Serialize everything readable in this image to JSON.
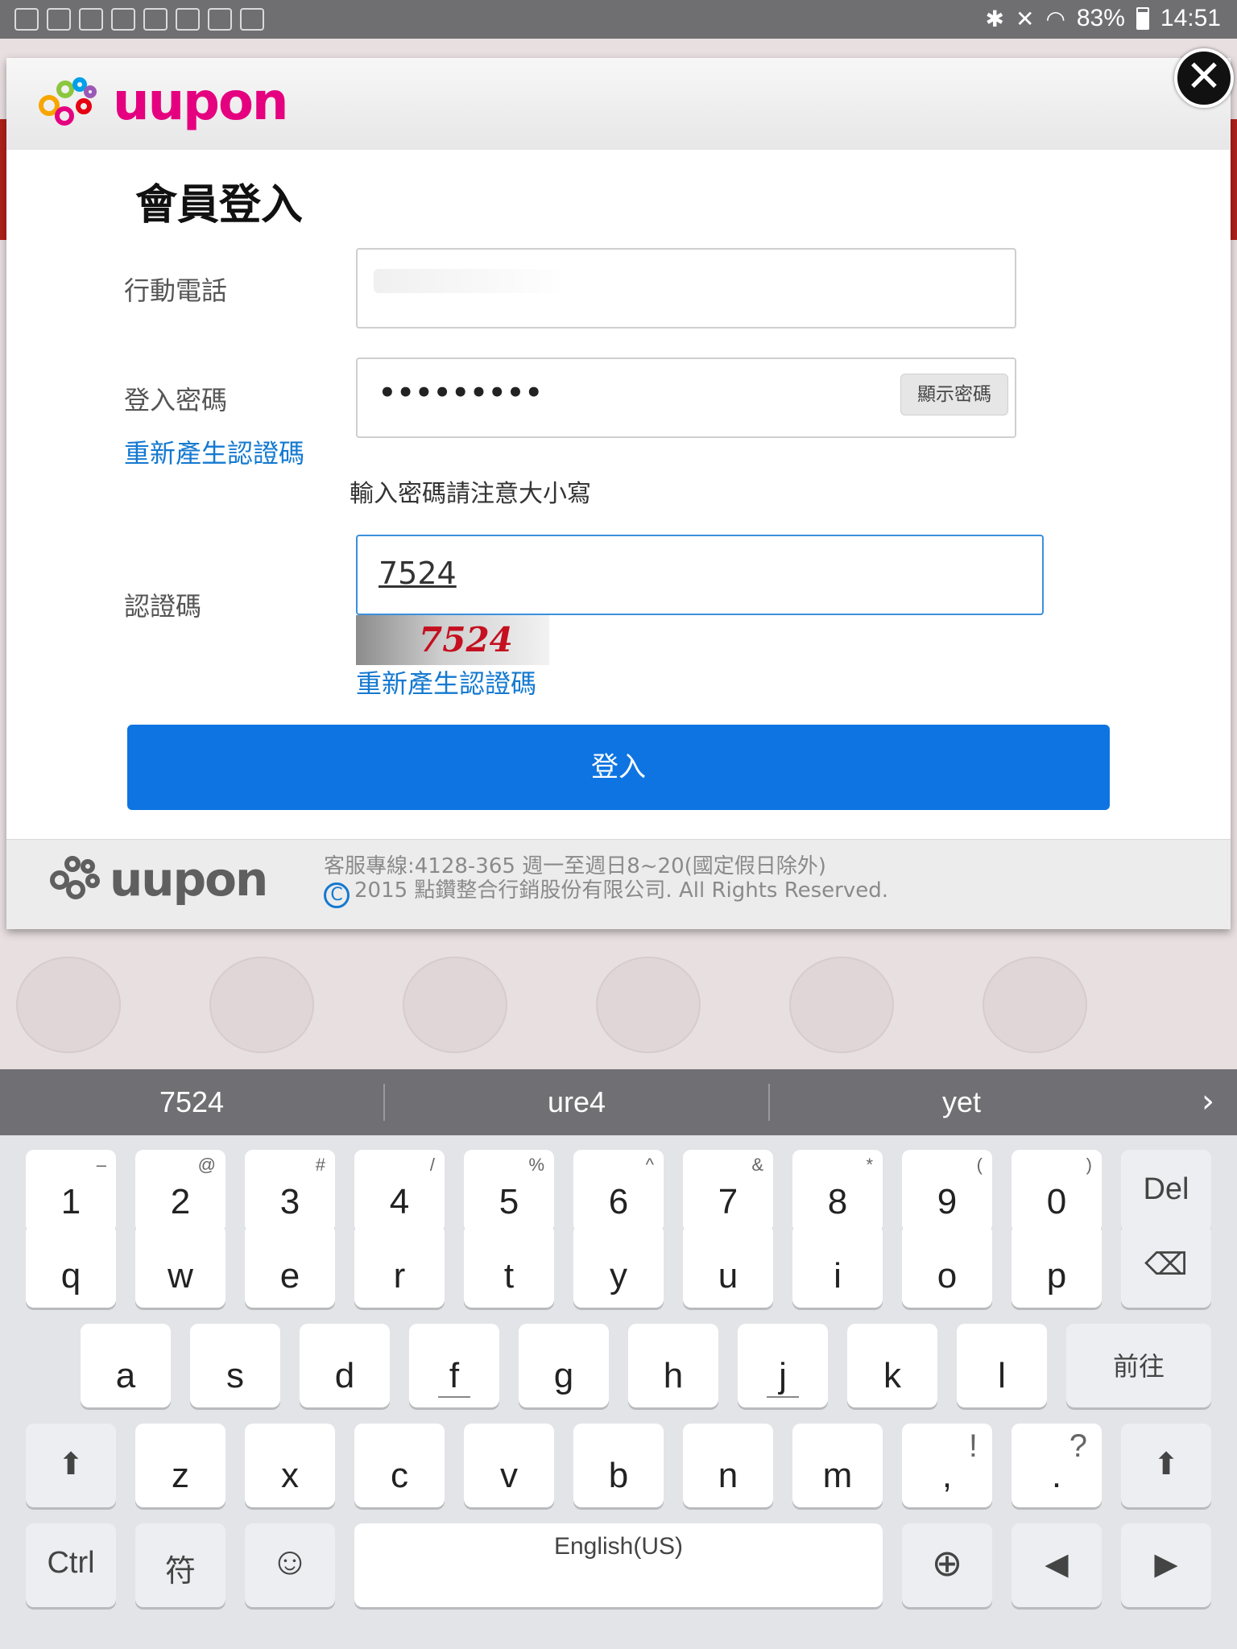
{
  "status_bar": {
    "battery": "83%",
    "time": "14:51"
  },
  "modal": {
    "brand": "uupon",
    "close_symbol": "✕",
    "title": "會員登入",
    "phone_label": "行動電話",
    "password_label": "登入密碼",
    "password_value": "•••••••••",
    "show_password_label": "顯示密碼",
    "regen_link_left": "重新產生認證碼",
    "password_hint": "輸入密碼請注意大小寫",
    "captcha_label": "認證碼",
    "captcha_input_value": "7524",
    "captcha_image_text": "7524",
    "regen_link": "重新產生認證碼",
    "login_button": "登入",
    "footer_logo": "uupon",
    "footer_service": "客服專線:4128-365 週一至週日8~20(國定假日除外)",
    "footer_copyright": "2015 點鑽整合行銷股份有限公司. All Rights Reserved.",
    "copyright_symbol": "C"
  },
  "suggestions": {
    "items": [
      "7524",
      "ure4",
      "yet"
    ],
    "more": "›"
  },
  "keyboard": {
    "row_numbers": [
      {
        "main": "1",
        "sup": "–"
      },
      {
        "main": "2",
        "sup": "@"
      },
      {
        "main": "3",
        "sup": "#"
      },
      {
        "main": "4",
        "sup": "/"
      },
      {
        "main": "5",
        "sup": "%"
      },
      {
        "main": "6",
        "sup": "^"
      },
      {
        "main": "7",
        "sup": "&"
      },
      {
        "main": "8",
        "sup": "*"
      },
      {
        "main": "9",
        "sup": "("
      },
      {
        "main": "0",
        "sup": ")"
      }
    ],
    "del": "Del",
    "row_q": [
      "q",
      "w",
      "e",
      "r",
      "t",
      "y",
      "u",
      "i",
      "o",
      "p"
    ],
    "backspace_symbol": "⌫",
    "row_a": [
      "a",
      "s",
      "d",
      "f",
      "g",
      "h",
      "j",
      "k",
      "l"
    ],
    "go": "前往",
    "row_z": [
      "z",
      "x",
      "c",
      "v",
      "b",
      "n",
      "m"
    ],
    "comma": ",",
    "comma_sup": "!",
    "period": ".",
    "period_sup": "?",
    "shift_symbol": "⬆",
    "ctrl": "Ctrl",
    "symbols": "符",
    "emoji_symbol": "☺",
    "space": "English(US)",
    "globe_symbol": "⊕",
    "left_symbol": "◀",
    "right_symbol": "▶"
  }
}
